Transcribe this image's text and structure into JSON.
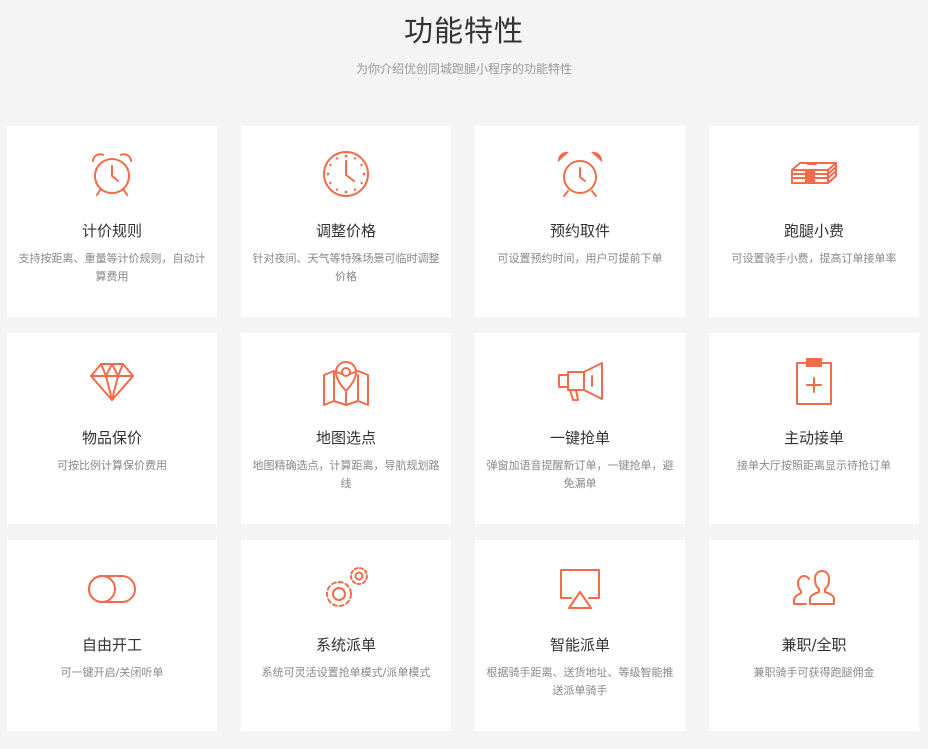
{
  "section": {
    "title": "功能特性",
    "subtitle": "为你介绍优创同城跑腿小程序的功能特性",
    "accent_color": "#f26b4a"
  },
  "features": [
    {
      "icon": "alarm-clock-icon",
      "title": "计价规则",
      "desc": "支持按距离、重量等计价规则，自动计算费用"
    },
    {
      "icon": "clock-icon",
      "title": "调整价格",
      "desc": "针对夜间、天气等特殊场景可临时调整价格"
    },
    {
      "icon": "alarm-bell-icon",
      "title": "预约取件",
      "desc": "可设置预约时间，用户可提前下单"
    },
    {
      "icon": "money-stack-icon",
      "title": "跑腿小费",
      "desc": "可设置骑手小费，提高订单接单率"
    },
    {
      "icon": "diamond-icon",
      "title": "物品保价",
      "desc": "可按比例计算保价费用"
    },
    {
      "icon": "map-pin-icon",
      "title": "地图选点",
      "desc": "地图精确选点，计算距离，导航规划路线"
    },
    {
      "icon": "megaphone-icon",
      "title": "一键抢单",
      "desc": "弹窗加语音提醒新订单，一键抢单，避免漏单"
    },
    {
      "icon": "clipboard-plus-icon",
      "title": "主动接单",
      "desc": "接单大厅按照距离显示待抢订单"
    },
    {
      "icon": "toggle-icon",
      "title": "自由开工",
      "desc": "可一键开启/关闭听单"
    },
    {
      "icon": "gears-icon",
      "title": "系统派单",
      "desc": "系统可灵活设置抢单模式/派单模式"
    },
    {
      "icon": "airplay-icon",
      "title": "智能派单",
      "desc": "根据骑手距离、送货地址、等级智能推送派单骑手"
    },
    {
      "icon": "users-icon",
      "title": "兼职/全职",
      "desc": "兼职骑手可获得跑腿佣金"
    }
  ]
}
